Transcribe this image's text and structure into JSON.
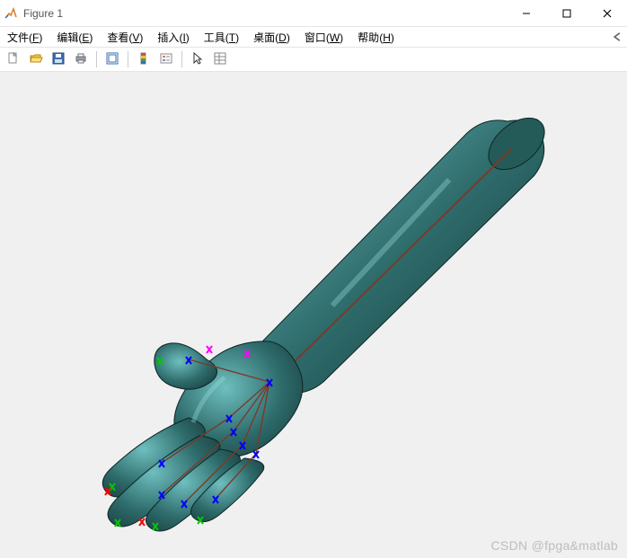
{
  "window": {
    "title": "Figure 1"
  },
  "menubar": {
    "items": [
      {
        "label": "文件",
        "mnemonic": "F"
      },
      {
        "label": "编辑",
        "mnemonic": "E"
      },
      {
        "label": "查看",
        "mnemonic": "V"
      },
      {
        "label": "插入",
        "mnemonic": "I"
      },
      {
        "label": "工具",
        "mnemonic": "T"
      },
      {
        "label": "桌面",
        "mnemonic": "D"
      },
      {
        "label": "窗口",
        "mnemonic": "W"
      },
      {
        "label": "帮助",
        "mnemonic": "H"
      }
    ]
  },
  "toolbar": {
    "icons": {
      "new": "new-icon",
      "open": "open-icon",
      "save": "save-icon",
      "print": "print-icon",
      "data_cursor": "data-cursor-icon",
      "rotate": "rotate-icon",
      "color": "color-icon",
      "pointer": "pointer-icon",
      "insert_legend": "insert-legend-icon"
    }
  },
  "figure": {
    "content_type": "3D surface rendering",
    "subject": "Human hand and forearm with skeletal/joint markers",
    "surface_color": "#2e6b6b",
    "highlight_color": "#6fbfbf",
    "bone_line_color": "#7a3a2a",
    "marker_colors": [
      "#0000ff",
      "#ff00ff",
      "#00ff00",
      "#ff0000"
    ]
  },
  "watermark": "CSDN @fpga&matlab"
}
